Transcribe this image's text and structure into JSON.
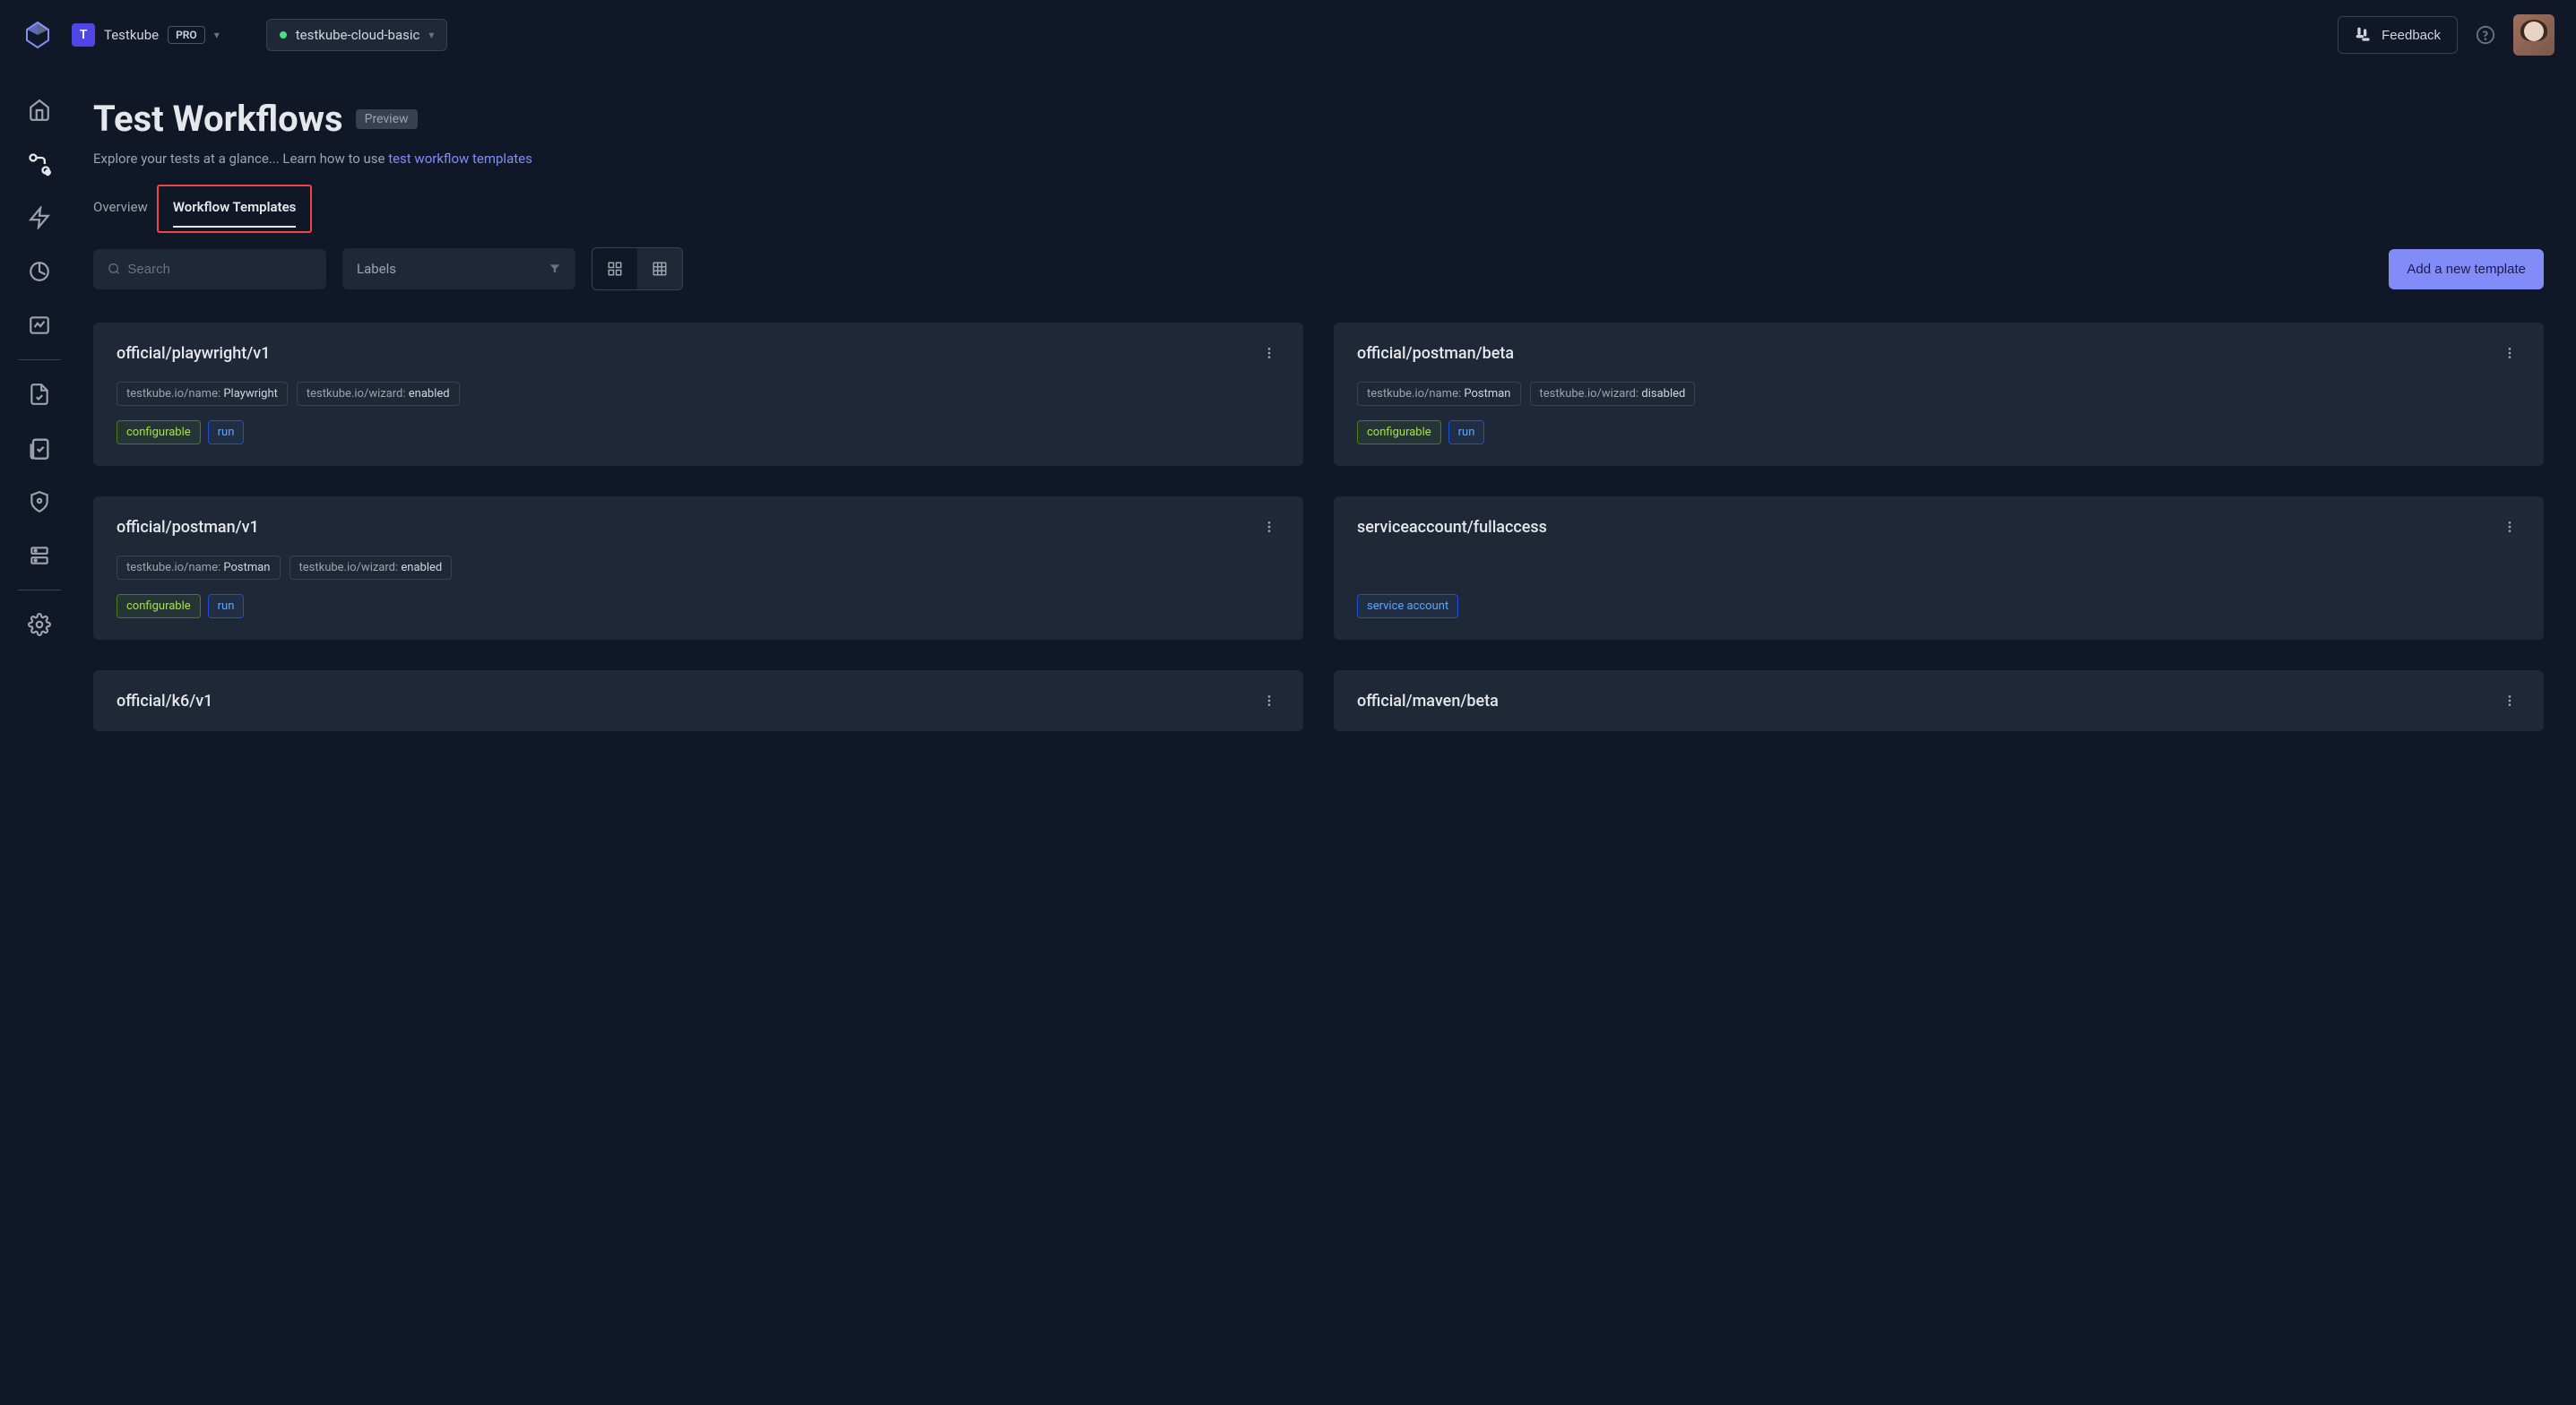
{
  "header": {
    "org_initial": "T",
    "org_name": "Testkube",
    "pro_badge": "PRO",
    "env_name": "testkube-cloud-basic",
    "feedback_label": "Feedback"
  },
  "page": {
    "title": "Test Workflows",
    "preview_badge": "Preview",
    "subtitle_prefix": "Explore your tests at a glance... Learn how to use ",
    "subtitle_link": "test workflow templates"
  },
  "tabs": {
    "overview": "Overview",
    "workflow_templates": "Workflow Templates"
  },
  "filters": {
    "search_placeholder": "Search",
    "labels_placeholder": "Labels",
    "add_button": "Add a new template"
  },
  "cards": [
    {
      "title": "official/playwright/v1",
      "info": [
        {
          "key": "testkube.io/name: ",
          "value": "Playwright"
        },
        {
          "key": "testkube.io/wizard: ",
          "value": "enabled"
        }
      ],
      "status": [
        {
          "text": "configurable",
          "color": "green"
        },
        {
          "text": "run",
          "color": "blue"
        }
      ]
    },
    {
      "title": "official/postman/beta",
      "info": [
        {
          "key": "testkube.io/name: ",
          "value": "Postman"
        },
        {
          "key": "testkube.io/wizard: ",
          "value": "disabled"
        }
      ],
      "status": [
        {
          "text": "configurable",
          "color": "green"
        },
        {
          "text": "run",
          "color": "blue"
        }
      ]
    },
    {
      "title": "official/postman/v1",
      "info": [
        {
          "key": "testkube.io/name: ",
          "value": "Postman"
        },
        {
          "key": "testkube.io/wizard: ",
          "value": "enabled"
        }
      ],
      "status": [
        {
          "text": "configurable",
          "color": "green"
        },
        {
          "text": "run",
          "color": "blue"
        }
      ]
    },
    {
      "title": "serviceaccount/fullaccess",
      "info": [],
      "status": [
        {
          "text": "service account",
          "color": "blue"
        }
      ]
    },
    {
      "title": "official/k6/v1",
      "info": [],
      "status": []
    },
    {
      "title": "official/maven/beta",
      "info": [],
      "status": []
    }
  ]
}
